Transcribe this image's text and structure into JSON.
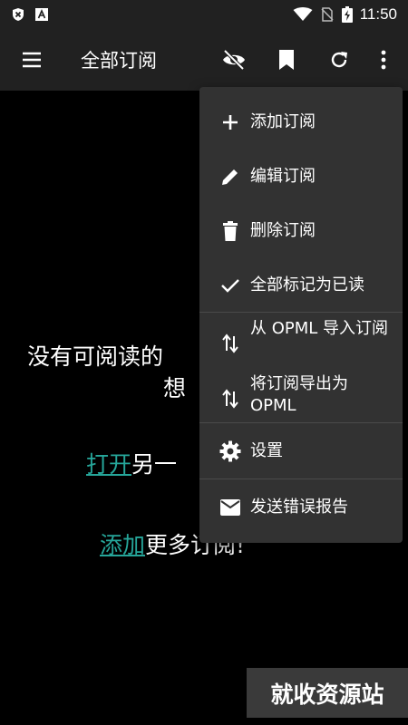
{
  "status_bar": {
    "time": "11:50",
    "left_icons": [
      "shield-x-icon",
      "app-a-icon"
    ],
    "right_icons": [
      "wifi-icon",
      "no-sim-icon",
      "battery-charging-icon"
    ]
  },
  "toolbar": {
    "title": "全部订阅",
    "actions": [
      "visibility-off-icon",
      "bookmark-icon",
      "refresh-icon",
      "more-vert-icon"
    ]
  },
  "content": {
    "empty_line1": "没有可阅读的",
    "empty_line2": "想",
    "open_link": "打开",
    "open_suffix": "另一",
    "add_link": "添加",
    "add_suffix": "更多订阅!"
  },
  "menu": {
    "items": [
      {
        "label": "添加订阅",
        "icon": "plus-icon"
      },
      {
        "label": "编辑订阅",
        "icon": "pencil-icon"
      },
      {
        "label": "删除订阅",
        "icon": "trash-icon"
      },
      {
        "label": "全部标记为已读",
        "icon": "check-icon"
      },
      {
        "label": "从 OPML 导入订阅",
        "icon": "import-export-icon"
      },
      {
        "label": "将订阅导出为 OPML",
        "icon": "import-export-icon"
      },
      {
        "label": "设置",
        "icon": "gear-icon"
      },
      {
        "label": "发送错误报告",
        "icon": "mail-icon"
      }
    ]
  },
  "watermark": "就收资源站",
  "colors": {
    "accent": "#26a69a",
    "toolbar": "#212121",
    "menu": "#323232"
  }
}
